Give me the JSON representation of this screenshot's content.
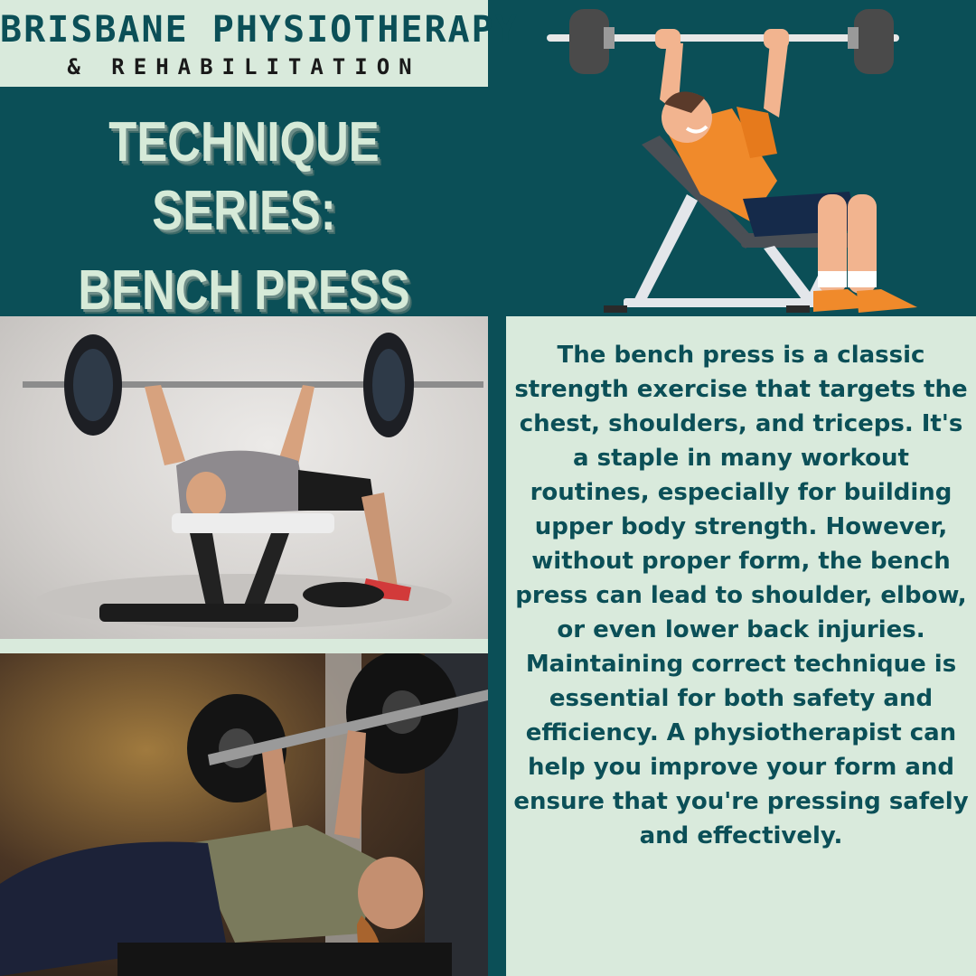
{
  "brand": {
    "name": "BRISBANE PHYSIOTHERAPY",
    "subtitle": "& REHABILITATION"
  },
  "title": {
    "line1": "TECHNIQUE SERIES:",
    "line2": "BENCH PRESS"
  },
  "colors": {
    "teal": "#0b4f57",
    "mint": "#d9eadc",
    "orange": "#f08a2b",
    "navy": "#152a4a"
  },
  "description": "The bench press is a classic strength exercise that targets the chest, shoulders, and triceps. It's a staple in many workout routines, especially for building upper body strength. However, without proper form, the bench press can lead to shoulder, elbow, or even lower back injuries. Maintaining correct technique is essential for both safety and efficiency. A physiotherapist can help you improve your form and ensure that you're pressing safely and effectively."
}
